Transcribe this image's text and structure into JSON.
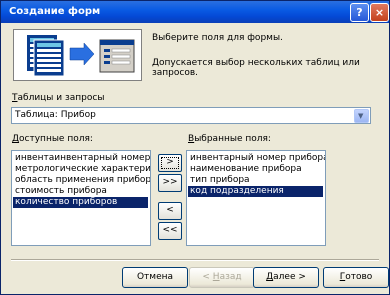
{
  "window": {
    "title": "Создание форм",
    "help_label": "?",
    "close_label": "×"
  },
  "instructions": {
    "line1": "Выберите поля для формы.",
    "line2": "Допускается выбор нескольких таблиц или запросов."
  },
  "tables": {
    "label_first": "Т",
    "label_rest": "аблицы и запросы",
    "selected": "Таблица: Прибор"
  },
  "available": {
    "label_first": "Д",
    "label_rest": "оступные поля:",
    "items": [
      "инвентаинвентарный номер прибора",
      "метрологические характеристики",
      "область применения прибора",
      "стоимость прибора",
      "количество приборов"
    ],
    "selected_index": 4
  },
  "selected": {
    "label_first": "В",
    "label_rest": "ыбранные поля:",
    "items": [
      "инвентарный номер прибора",
      "наименование прибора",
      "тип прибора",
      "код подразделения"
    ],
    "selected_index": 3
  },
  "move_buttons": {
    "add_one": ">",
    "add_all": ">>",
    "remove_one": "<",
    "remove_all": "<<"
  },
  "buttons": {
    "cancel": "Отмена",
    "back_first": "< ",
    "back_u": "Н",
    "back_rest": "азад",
    "next_first": "Д",
    "next_rest": "алее >",
    "finish_first": "Г",
    "finish_rest": "отово"
  },
  "colors": {
    "titlebar": "#0a5be3",
    "selection": "#0a246a",
    "face": "#ece9d8"
  },
  "icons": [
    "help-icon",
    "close-icon",
    "chevron-down-icon",
    "form-wizard-icon"
  ]
}
